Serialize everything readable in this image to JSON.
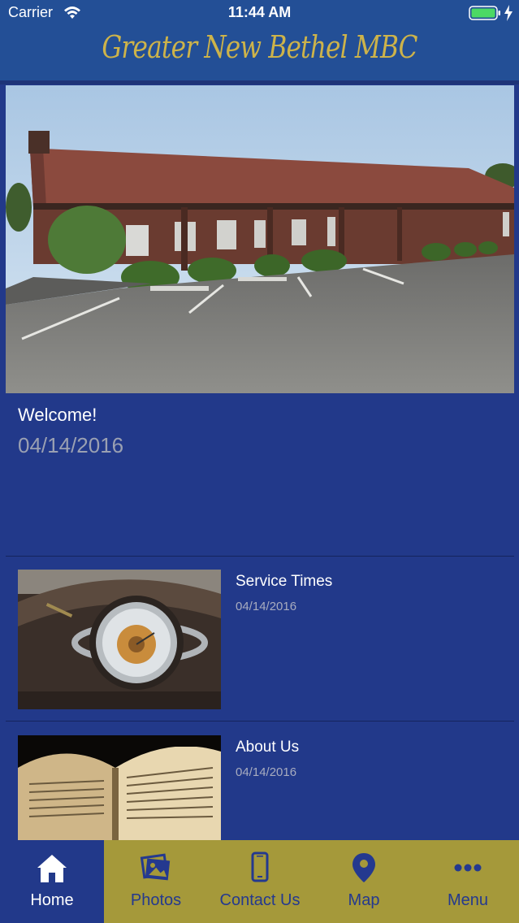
{
  "status_bar": {
    "carrier": "Carrier",
    "time": "11:44 AM"
  },
  "header": {
    "title": "Greater New Bethel MBC"
  },
  "welcome": {
    "title": "Welcome!",
    "date": "04/14/2016"
  },
  "cards": [
    {
      "title": "Service Times",
      "date": "04/14/2016",
      "image": "pocket-watch"
    },
    {
      "title": "About Us",
      "date": "04/14/2016",
      "image": "open-bible"
    }
  ],
  "tabs": [
    {
      "label": "Home",
      "icon": "home-icon",
      "active": true
    },
    {
      "label": "Photos",
      "icon": "photos-icon",
      "active": false
    },
    {
      "label": "Contact Us",
      "icon": "phone-icon",
      "active": false
    },
    {
      "label": "Map",
      "icon": "map-pin-icon",
      "active": false
    },
    {
      "label": "Menu",
      "icon": "more-icon",
      "active": false
    }
  ],
  "colors": {
    "header_bg": "#234f96",
    "page_bg": "#22398a",
    "title_gold": "#cdb34a",
    "tabbar_bg": "#a5993a",
    "battery_green": "#4cd964"
  }
}
